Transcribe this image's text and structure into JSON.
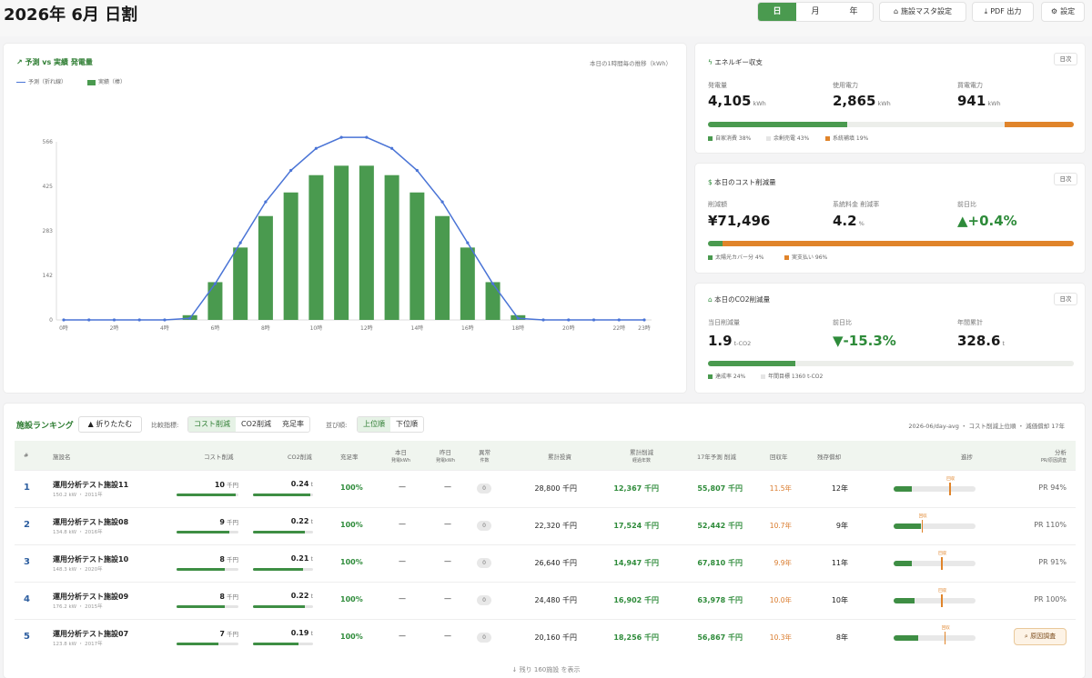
{
  "header": {
    "title": "2026年 6月 日割",
    "period_tabs": [
      {
        "label": "日",
        "active": true
      },
      {
        "label": "月",
        "active": false
      },
      {
        "label": "年",
        "active": false
      }
    ],
    "master_button": "施設マスタ設定",
    "pdf_button": "PDF 出力",
    "settings_button": "設定"
  },
  "chart_card": {
    "title": "予測 vs 実績 発電量",
    "note": "本日の1時間毎の推移（kWh）",
    "legend_forecast": "予測（折れ線）",
    "legend_actual": "実績（棒）"
  },
  "chart_data": {
    "type": "bar",
    "title": "予測 vs 実績 発電量",
    "ylabel": "",
    "xlabel": "",
    "ylim": [
      0,
      566
    ],
    "yticks": [
      "0",
      "142",
      "283",
      "425",
      "566"
    ],
    "categories": [
      "0時",
      "1時",
      "2時",
      "3時",
      "4時",
      "5時",
      "6時",
      "7時",
      "8時",
      "9時",
      "10時",
      "11時",
      "12時",
      "13時",
      "14時",
      "15時",
      "16時",
      "17時",
      "18時",
      "19時",
      "20時",
      "21時",
      "22時",
      "23時"
    ],
    "xtick_labels": [
      "0時",
      "",
      "2時",
      "",
      "4時",
      "",
      "6時",
      "",
      "8時",
      "",
      "10時",
      "",
      "12時",
      "",
      "14時",
      "",
      "16時",
      "",
      "18時",
      "",
      "20時",
      "",
      "22時",
      "23時"
    ],
    "series": [
      {
        "name": "予測（折れ線）",
        "type": "line",
        "color": "#4a74d6",
        "values": [
          0,
          0,
          0,
          0,
          0,
          5,
          115,
          245,
          375,
          475,
          545,
          580,
          580,
          545,
          475,
          375,
          245,
          115,
          5,
          0,
          0,
          0,
          0,
          0
        ]
      },
      {
        "name": "実績（棒）",
        "type": "bar",
        "color": "#4a9a4f",
        "values": [
          0,
          0,
          0,
          0,
          0,
          15,
          120,
          230,
          330,
          405,
          460,
          490,
          490,
          460,
          405,
          330,
          230,
          120,
          15,
          0,
          0,
          0,
          0,
          0
        ]
      }
    ],
    "grid": false,
    "legend_position": "top-left"
  },
  "energy_card": {
    "title": "エネルギー収支",
    "button": "日次",
    "stats": [
      {
        "label": "発電量",
        "value": "4,105",
        "unit": "kWh"
      },
      {
        "label": "使用電力",
        "value": "2,865",
        "unit": "kWh"
      },
      {
        "label": "買電電力",
        "value": "941",
        "unit": "kWh"
      }
    ],
    "bar": [
      {
        "fraction": 0.38,
        "color": "#4a9a4f"
      },
      {
        "fraction": 0.43,
        "color": "#eceeea"
      },
      {
        "fraction": 0.19,
        "color": "#e0842a"
      }
    ],
    "legend": [
      {
        "label": "自家消費 38%",
        "color": "#4a9a4f"
      },
      {
        "label": "余剰売電 43%",
        "color": "#e5e5e5"
      },
      {
        "label": "系統補填 19%",
        "color": "#e0842a"
      }
    ]
  },
  "cost_card": {
    "title": "本日のコスト削減量",
    "button": "日次",
    "stats": [
      {
        "label": "削減額",
        "value": "¥71,496",
        "unit": ""
      },
      {
        "label": "系統料金 削減率",
        "value": "4.2",
        "unit": "%"
      },
      {
        "label": "前日比",
        "value": "▲+0.4%",
        "unit": ""
      }
    ],
    "bar": [
      {
        "fraction": 0.04,
        "color": "#4a9a4f"
      },
      {
        "fraction": 0.96,
        "color": "#e0842a"
      }
    ],
    "legend": [
      {
        "label": "太陽光カバー分 4%",
        "color": "#4a9a4f"
      },
      {
        "label": "実支払い 96%",
        "color": "#e0842a"
      }
    ]
  },
  "co2_card": {
    "title": "本日のCO2削減量",
    "button": "日次",
    "stats": [
      {
        "label": "当日削減量",
        "value": "1.9",
        "unit": "t-CO2"
      },
      {
        "label": "前日比",
        "value": "▼-15.3%",
        "unit": ""
      },
      {
        "label": "年間累計",
        "value": "328.6",
        "unit": "t"
      }
    ],
    "bar": [
      {
        "fraction": 0.24,
        "color": "#4a9a4f"
      },
      {
        "fraction": 0.76,
        "color": "#eceeea"
      }
    ],
    "legend": [
      {
        "label": "達成率 24%",
        "color": "#4a9a4f"
      },
      {
        "label": "年間目標 1360 t-CO2",
        "color": "#e5e5e5"
      }
    ]
  },
  "ranking": {
    "title": "施設ランキング",
    "fold_button": "▲ 折りたたむ",
    "metric_label": "比較指標:",
    "metric_options": [
      {
        "label": "コスト削減",
        "active": true
      },
      {
        "label": "CO2削減",
        "active": false
      },
      {
        "label": "充足率",
        "active": false
      }
    ],
    "order_label": "並び順:",
    "order_options": [
      {
        "label": "上位順",
        "active": true
      },
      {
        "label": "下位順",
        "active": false
      }
    ],
    "summary": "2026-06/day-avg ・ コスト削減上位順 ・ 減価償却 17年",
    "columns": [
      {
        "label": "#",
        "sub": ""
      },
      {
        "label": "施設名",
        "sub": ""
      },
      {
        "label": "コスト削減",
        "sub": ""
      },
      {
        "label": "CO2削減",
        "sub": ""
      },
      {
        "label": "充足率",
        "sub": ""
      },
      {
        "label": "本日",
        "sub": "発電kWh"
      },
      {
        "label": "昨日",
        "sub": "発電kWh"
      },
      {
        "label": "異常",
        "sub": "件数"
      },
      {
        "label": "累計投資",
        "sub": ""
      },
      {
        "label": "累計削減",
        "sub": "経過年数"
      },
      {
        "label": "17年予測 削減",
        "sub": ""
      },
      {
        "label": "回収年",
        "sub": ""
      },
      {
        "label": "残存償却",
        "sub": ""
      },
      {
        "label": "進捗",
        "sub": ""
      },
      {
        "label": "分析",
        "sub": "PR/原因調査"
      }
    ],
    "rows": [
      {
        "rank": "1",
        "name": "運用分析テスト施設11",
        "meta": "150.2 kW ・ 2011年",
        "cost": "10",
        "cost_unit": "千円",
        "cost_frac": 0.95,
        "co2": "0.24",
        "co2_unit": "t",
        "co2_frac": 0.95,
        "rate": "100%",
        "today": "—",
        "yesterday": "—",
        "alerts": "0",
        "invest": "28,800 千円",
        "saved": "12,367 千円",
        "forecast": "55,807 千円",
        "payback": "11.5年",
        "remain": "12年",
        "progress": 0.22,
        "marker": 0.68,
        "marker_label": "回収",
        "analysis": "PR 94%"
      },
      {
        "rank": "2",
        "name": "運用分析テスト施設08",
        "meta": "134.8 kW ・ 2016年",
        "cost": "9",
        "cost_unit": "千円",
        "cost_frac": 0.85,
        "co2": "0.22",
        "co2_unit": "t",
        "co2_frac": 0.86,
        "rate": "100%",
        "today": "—",
        "yesterday": "—",
        "alerts": "0",
        "invest": "22,320 千円",
        "saved": "17,524 千円",
        "forecast": "52,442 千円",
        "payback": "10.7年",
        "remain": "9年",
        "progress": 0.33,
        "marker": 0.34,
        "marker_label": "回収",
        "analysis": "PR 110%"
      },
      {
        "rank": "3",
        "name": "運用分析テスト施設10",
        "meta": "148.3 kW ・ 2020年",
        "cost": "8",
        "cost_unit": "千円",
        "cost_frac": 0.78,
        "co2": "0.21",
        "co2_unit": "t",
        "co2_frac": 0.83,
        "rate": "100%",
        "today": "—",
        "yesterday": "—",
        "alerts": "0",
        "invest": "26,640 千円",
        "saved": "14,947 千円",
        "forecast": "67,810 千円",
        "payback": "9.9年",
        "remain": "11年",
        "progress": 0.22,
        "marker": 0.58,
        "marker_label": "回収",
        "analysis": "PR 91%"
      },
      {
        "rank": "4",
        "name": "運用分析テスト施設09",
        "meta": "176.2 kW ・ 2015年",
        "cost": "8",
        "cost_unit": "千円",
        "cost_frac": 0.78,
        "co2": "0.22",
        "co2_unit": "t",
        "co2_frac": 0.86,
        "rate": "100%",
        "today": "—",
        "yesterday": "—",
        "alerts": "0",
        "invest": "24,480 千円",
        "saved": "16,902 千円",
        "forecast": "63,978 千円",
        "payback": "10.0年",
        "remain": "10年",
        "progress": 0.25,
        "marker": 0.58,
        "marker_label": "回収",
        "analysis": "PR 100%"
      },
      {
        "rank": "5",
        "name": "運用分析テスト施設07",
        "meta": "123.8 kW ・ 2017年",
        "cost": "7",
        "cost_unit": "千円",
        "cost_frac": 0.68,
        "co2": "0.19",
        "co2_unit": "t",
        "co2_frac": 0.76,
        "rate": "100%",
        "today": "—",
        "yesterday": "—",
        "alerts": "0",
        "invest": "20,160 千円",
        "saved": "18,256 千円",
        "forecast": "56,867 千円",
        "payback": "10.3年",
        "remain": "8年",
        "progress": 0.3,
        "marker": 0.62,
        "marker_label": "回収",
        "analysis": "",
        "action": "原因調査"
      }
    ],
    "more_link": "↓ 残り 160施設 を表示"
  }
}
